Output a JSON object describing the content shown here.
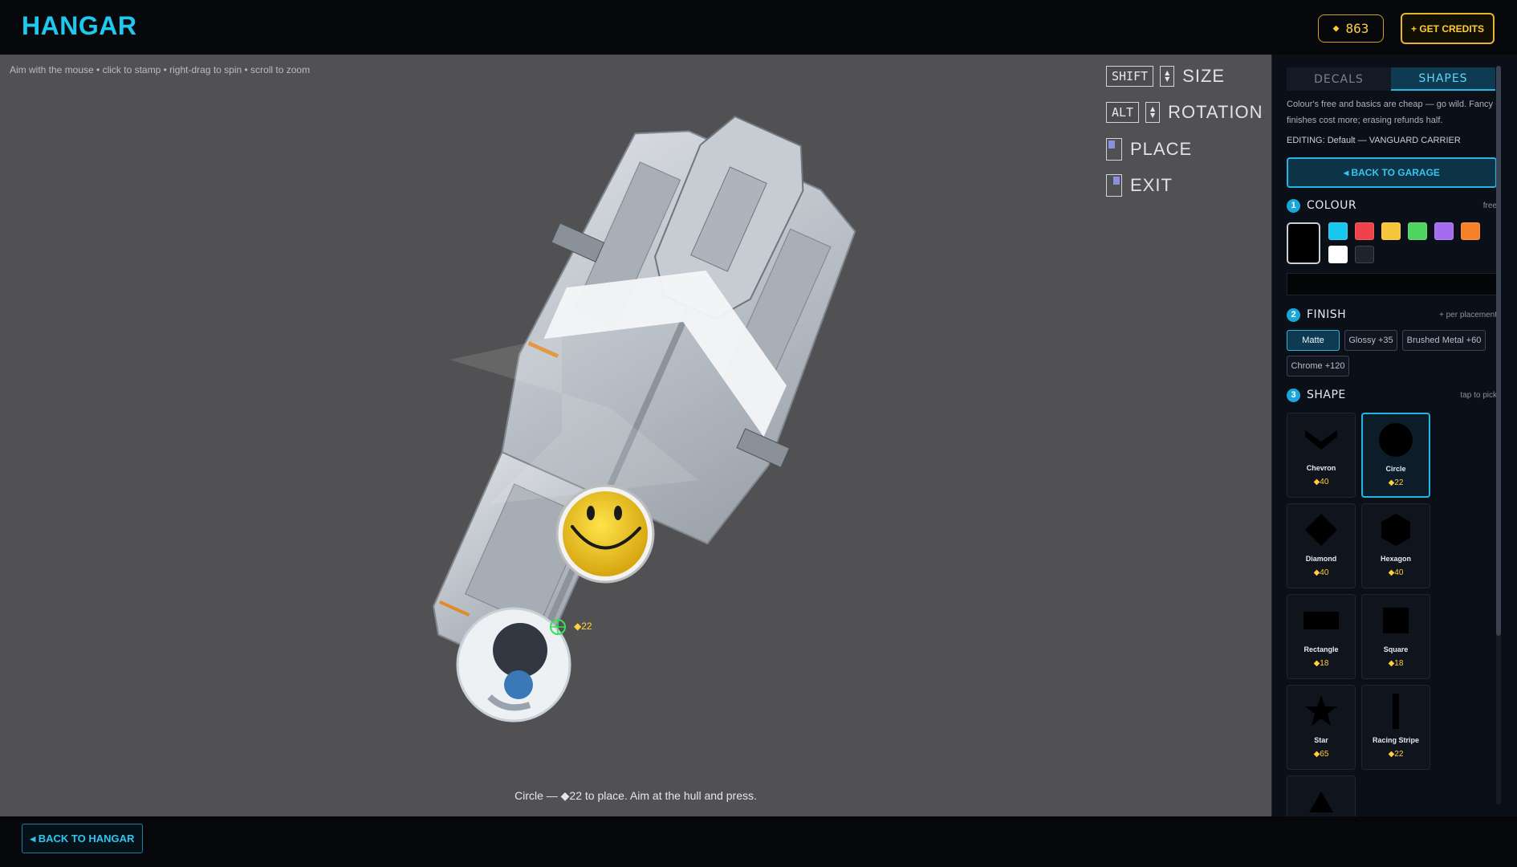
{
  "header": {
    "title": "HANGAR",
    "credits": "863",
    "get_credits_label": "+ GET CREDITS"
  },
  "viewport": {
    "hint": "Aim with the mouse • click to stamp • right-drag to spin • scroll to zoom",
    "controls": {
      "size": {
        "key": "SHIFT",
        "label": "SIZE"
      },
      "rotation": {
        "key": "ALT",
        "label": "ROTATION"
      },
      "place": {
        "label": "PLACE"
      },
      "exit": {
        "label": "EXIT"
      }
    },
    "cursor_cost": "◆22",
    "status": "Circle — ◆22 to place. Aim at the hull and press."
  },
  "footer": {
    "back_hangar_label": "◂ BACK TO HANGAR"
  },
  "panel": {
    "tabs": [
      {
        "label": "DECALS",
        "active": false
      },
      {
        "label": "SHAPES",
        "active": true
      }
    ],
    "description": "Colour's free and basics are cheap — go wild. Fancy finishes cost more; erasing refunds half.",
    "editing": "EDITING: Default — VANGUARD CARRIER",
    "back_garage_label": "◂ BACK TO GARAGE",
    "colour": {
      "num": "1",
      "title": "COLOUR",
      "note": "free",
      "selected": "#000000",
      "swatches": [
        "#19c6f0",
        "#f0424a",
        "#f7c53b",
        "#4fd45f",
        "#a56cf0",
        "#f5822a",
        "#ffffff",
        "#1e232c"
      ]
    },
    "finish": {
      "num": "2",
      "title": "FINISH",
      "note": "+ per placement",
      "options": [
        {
          "label": "Matte",
          "active": true
        },
        {
          "label": "Glossy +35",
          "active": false
        },
        {
          "label": "Brushed Metal +60",
          "active": false
        },
        {
          "label": "Chrome +120",
          "active": false
        }
      ]
    },
    "shape": {
      "num": "3",
      "title": "SHAPE",
      "note": "tap to pick",
      "items": [
        {
          "name": "Chevron",
          "cost": "◆40",
          "icon": "chevron-icon",
          "selected": false
        },
        {
          "name": "Circle",
          "cost": "◆22",
          "icon": "circle-icon",
          "selected": true
        },
        {
          "name": "Diamond",
          "cost": "◆40",
          "icon": "diamond-icon",
          "selected": false
        },
        {
          "name": "Hexagon",
          "cost": "◆40",
          "icon": "hexagon-icon",
          "selected": false
        },
        {
          "name": "Rectangle",
          "cost": "◆18",
          "icon": "rectangle-icon",
          "selected": false
        },
        {
          "name": "Square",
          "cost": "◆18",
          "icon": "square-icon",
          "selected": false
        },
        {
          "name": "Star",
          "cost": "◆65",
          "icon": "star-icon",
          "selected": false
        },
        {
          "name": "Racing Stripe",
          "cost": "◆22",
          "icon": "stripe-icon",
          "selected": false
        }
      ]
    }
  }
}
